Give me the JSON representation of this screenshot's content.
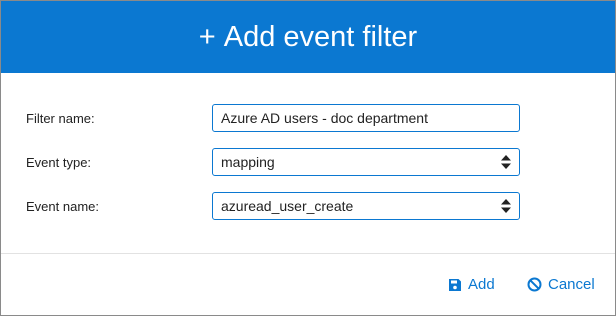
{
  "dialog": {
    "title_plus": "+",
    "title": "Add event filter"
  },
  "form": {
    "filter_name": {
      "label": "Filter name:",
      "value": "Azure AD users - doc department"
    },
    "event_type": {
      "label": "Event type:",
      "value": "mapping"
    },
    "event_name": {
      "label": "Event name:",
      "value": "azuread_user_create"
    }
  },
  "footer": {
    "add_label": "Add",
    "cancel_label": "Cancel"
  },
  "icons": {
    "add": "floppy-disk-icon",
    "cancel": "ban-icon",
    "select": "sort-arrows-icon"
  },
  "colors": {
    "accent": "#0b78d1",
    "header_text": "#ffffff"
  }
}
